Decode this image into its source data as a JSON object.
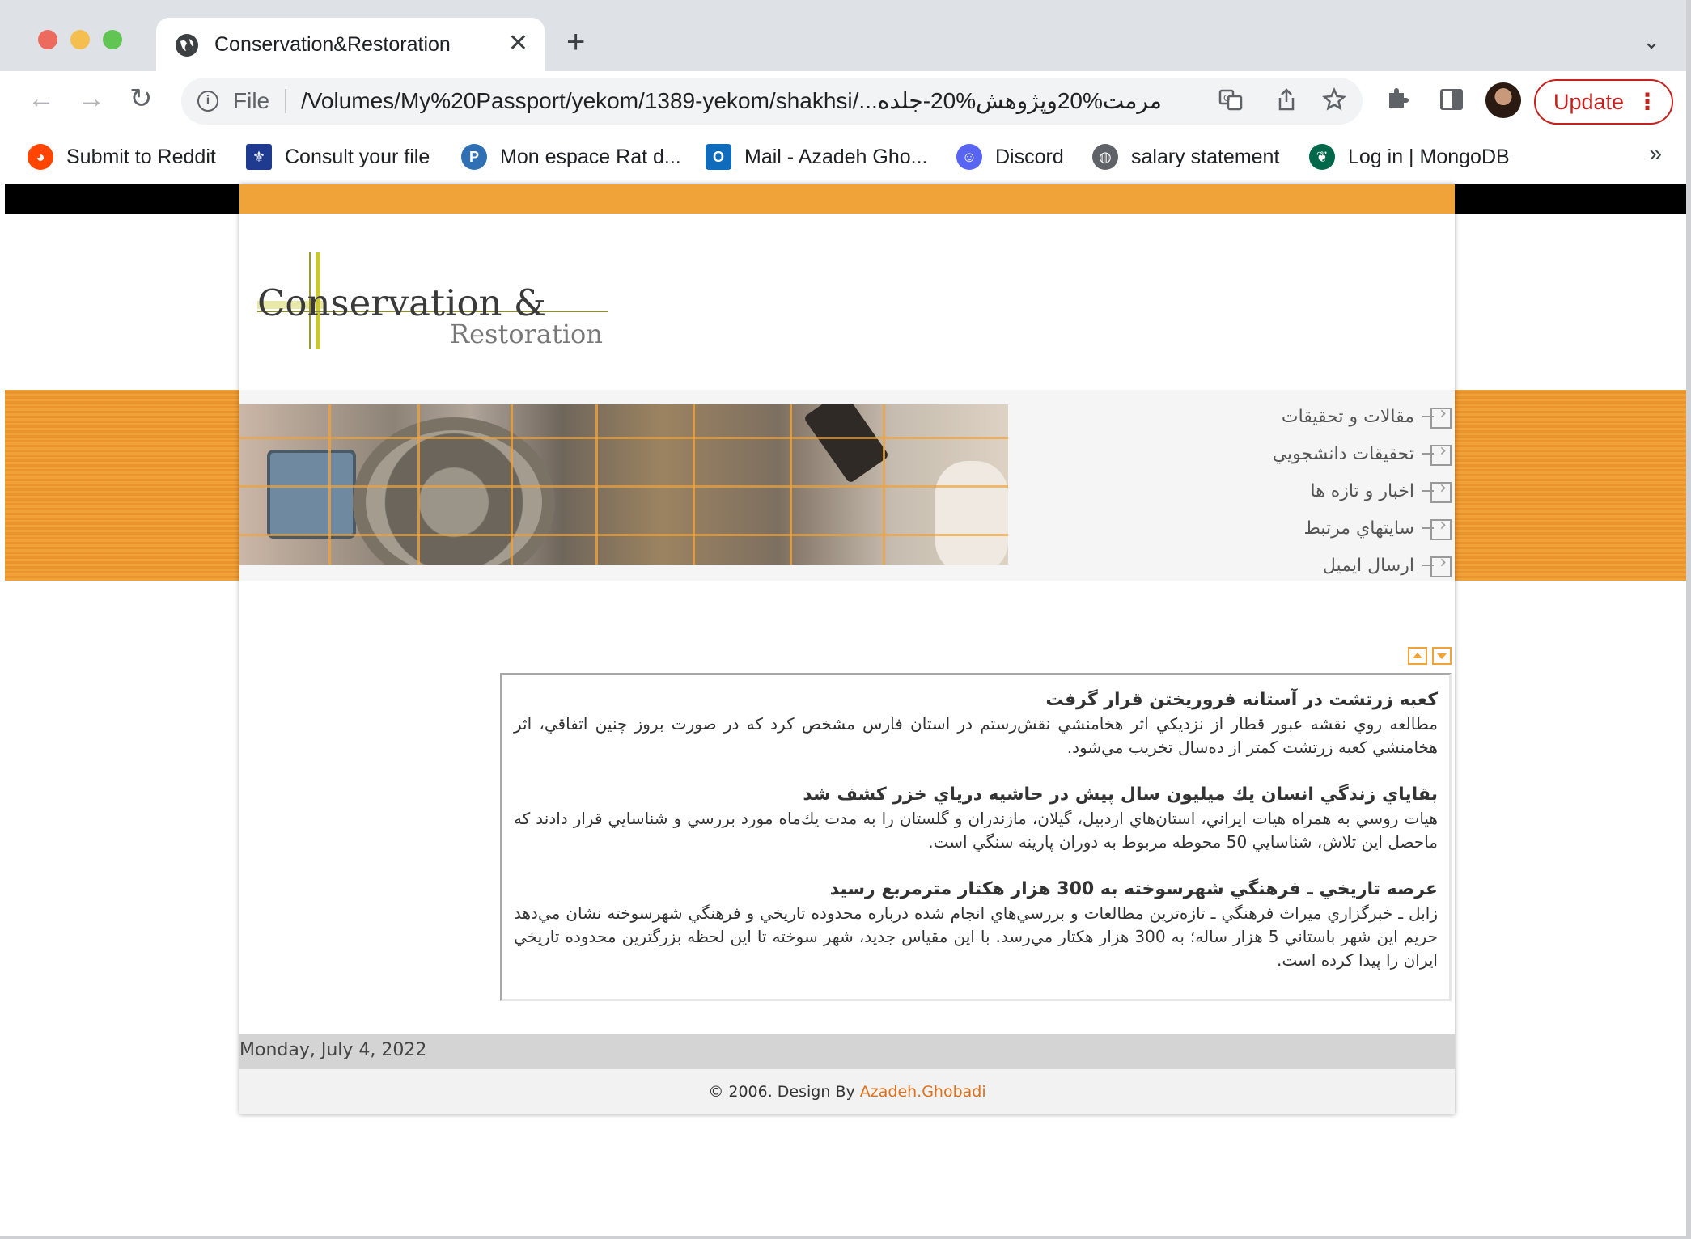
{
  "browser": {
    "tab_title": "Conservation&Restoration",
    "tab_close": "✕",
    "new_tab": "+",
    "tab_list": "⌄",
    "back": "←",
    "forward": "→",
    "reload": "↻",
    "omnibox_scheme": "File",
    "url": "/Volumes/My%20Passport/yekom/1389-yekom/shakhsi/...مرمت%20وپژوهش%20-جلده",
    "update_label": "Update",
    "update_menu": "⋮",
    "bookmarks_more": "»"
  },
  "bookmarks": [
    {
      "label": "Submit to Reddit",
      "icon": "reddit-icon",
      "color": "#ff4500"
    },
    {
      "label": "Consult your file",
      "icon": "quebec-fleur-icon",
      "color": "#1f3b8f"
    },
    {
      "label": "Mon espace Rat d...",
      "icon": "p-circle-icon",
      "color": "#2f6fb3"
    },
    {
      "label": "Mail - Azadeh Gho...",
      "icon": "outlook-icon",
      "color": "#0f6cbd"
    },
    {
      "label": "Discord",
      "icon": "discord-icon",
      "color": "#5865f2"
    },
    {
      "label": "salary statement",
      "icon": "globe-icon",
      "color": "#5f6368"
    },
    {
      "label": "Log in | MongoDB",
      "icon": "mongodb-leaf-icon",
      "color": "#00684a"
    }
  ],
  "site": {
    "logo_main": "Conservation &",
    "logo_sub": "Restoration",
    "nav": [
      "مقالات و تحقيقات",
      "تحقيقات دانشجويي",
      "اخبار و تازه ها",
      "سايتهاي مرتبط",
      "ارسال ايميل"
    ],
    "news": [
      {
        "title": "كعبه زرتشت در آستانه فروريختن قرار گرفت",
        "body": "مطالعه روي نقشه عبور قطار از نزديكي اثر هخامنشي نقش‌رستم در استان فارس مشخص كرد كه در صورت بروز چنين اتفاقي، اثر هخامنشي كعبه زرتشت كمتر از ده‌سال تخريب مي‌شود."
      },
      {
        "title": "بقاياي زندگي انسان يك ميليون سال پيش در حاشيه درياي خزر كشف شد",
        "body": "هيات روسي به همراه هيات ايراني، استان‌هاي اردبيل، گيلان، مازندران و گلستان را به مدت يك‌ماه مورد بررسي و شناسايي قرار دادند كه ماحصل اين تلاش، شناسايي 50 محوطه مربوط به دوران پارينه سنگي است."
      },
      {
        "title": "عرصه تاريخي ـ فرهنگي شهرسوخته به 300 هزار هكتار مترمربع رسيد",
        "body": "زابل ـ خبرگزاري ميراث فرهنگي ـ تازه‌ترين مطالعات و بررسي‌هاي انجام شده درباره محدوده تاريخي و فرهنگي شهرسوخته نشان مي‌دهد حريم اين شهر باستاني 5 هزار ساله؛ به 300 هزار هكتار مي‌رسد. با اين مقياس جديد، شهر سوخته تا اين لحظه بزرگترين محدوده تاريخي ايران را پيدا كرده است."
      }
    ],
    "date": "Monday, July 4, 2022",
    "footer_prefix": "© 2006. Design By ",
    "footer_link": "Azadeh.Ghobadi"
  },
  "colors": {
    "accent_orange": "#f0a339",
    "footer_link": "#e0701a",
    "update_red": "#c5221f"
  }
}
